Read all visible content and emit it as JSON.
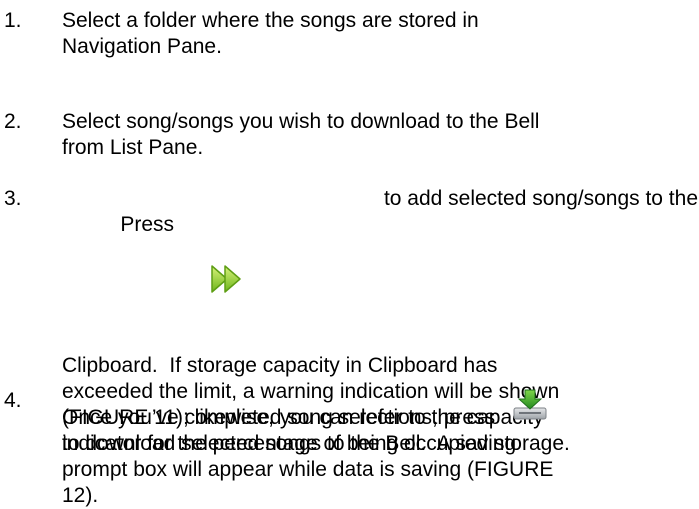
{
  "steps": [
    {
      "number": "1.",
      "lines": [
        "Select a folder where the songs are stored in",
        "Navigation Pane."
      ]
    },
    {
      "number": "2.",
      "lines": [
        "Select song/songs you wish to download to the Bell",
        "from List Pane."
      ]
    },
    {
      "number": "3.",
      "line1_before": "Press",
      "line1_after": "to add selected song/songs to the",
      "icon": "add-to-clipboard-arrows-icon",
      "lines": [
        "Clipboard.  If storage capacity in Clipboard has",
        "exceeded the limit, a warning indication will be shown",
        "(FIGURE 11); likewise, you can refer to the capacity",
        "indicator for the percentage of being occupied storage."
      ]
    },
    {
      "number": "4.",
      "line1": "Once you’ve completed song selections, press",
      "icon": "download-to-device-icon",
      "lines": [
        "to download selected songs to the Bell.  A saving",
        "prompt box will appear while data is saving (FIGURE",
        "12)."
      ]
    }
  ],
  "colors": {
    "text": "#000000",
    "icon_green": "#7dc41f",
    "icon_green_light": "#c9ec6a",
    "download_arrow": "#2e9a2e",
    "tray_gray": "#b8bcc0"
  }
}
